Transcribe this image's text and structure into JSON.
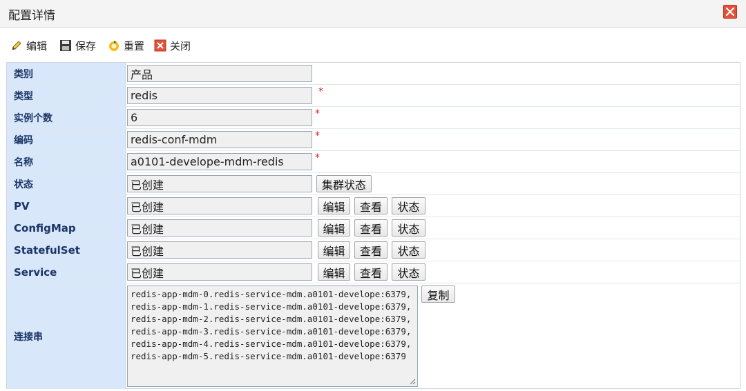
{
  "window": {
    "title": "配置详情",
    "close_icon": "close-icon"
  },
  "toolbar": {
    "edit_label": "编辑",
    "save_label": "保存",
    "reset_label": "重置",
    "close_label": "关闭"
  },
  "fields": {
    "category": {
      "label": "类别",
      "value": "产品"
    },
    "type": {
      "label": "类型",
      "value": "redis",
      "required": "*"
    },
    "instances": {
      "label": "实例个数",
      "value": "6",
      "required": "*"
    },
    "code": {
      "label": "编码",
      "value": "redis-conf-mdm",
      "required": "*"
    },
    "name": {
      "label": "名称",
      "value": "a0101-develope-mdm-redis",
      "required": "*"
    },
    "status": {
      "label": "状态",
      "value": "已创建",
      "cluster_button": "集群状态"
    },
    "pv": {
      "label": "PV",
      "value": "已创建"
    },
    "configmap": {
      "label": "ConfigMap",
      "value": "已创建"
    },
    "statefulset": {
      "label": "StatefulSet",
      "value": "已创建"
    },
    "service": {
      "label": "Service",
      "value": "已创建"
    },
    "connection": {
      "label": "连接串",
      "value": "redis-app-mdm-0.redis-service-mdm.a0101-develope:6379,redis-app-mdm-1.redis-service-mdm.a0101-develope:6379,redis-app-mdm-2.redis-service-mdm.a0101-develope:6379,redis-app-mdm-3.redis-service-mdm.a0101-develope:6379,redis-app-mdm-4.redis-service-mdm.a0101-develope:6379,redis-app-mdm-5.redis-service-mdm.a0101-develope:6379",
      "copy_button": "复制"
    }
  },
  "actions": {
    "edit": "编辑",
    "view": "查看",
    "status": "状态"
  },
  "colors": {
    "label_bg": "#d9e7fb",
    "label_text": "#1a3566",
    "required": "#e02020",
    "close_red": "#e0533a"
  }
}
